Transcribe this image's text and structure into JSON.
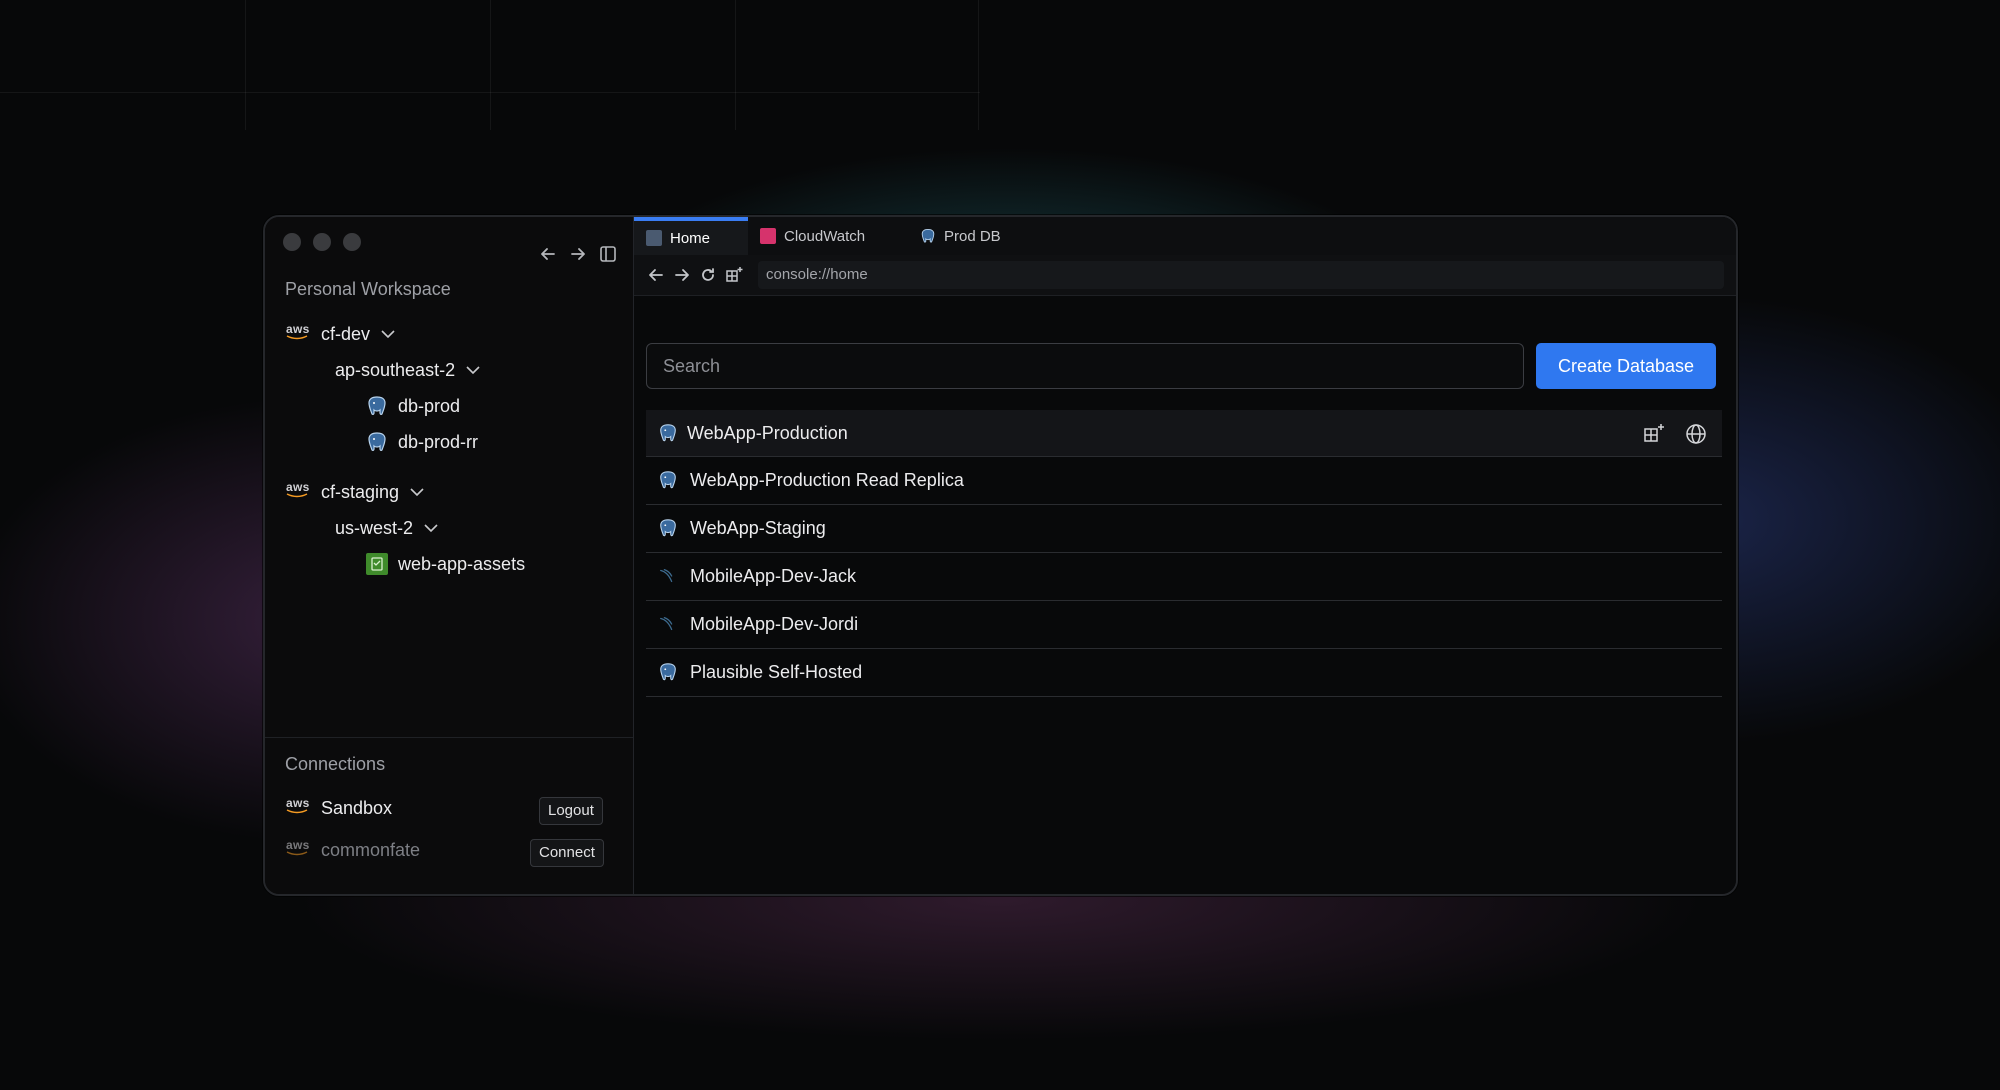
{
  "window": {
    "sidebar": {
      "workspace_title": "Personal Workspace",
      "tree": [
        {
          "provider": "aws",
          "label": "cf-dev",
          "expanded": true,
          "regions": [
            {
              "label": "ap-southeast-2",
              "expanded": true,
              "resources": [
                {
                  "type": "postgres",
                  "label": "db-prod"
                },
                {
                  "type": "postgres",
                  "label": "db-prod-rr"
                }
              ]
            }
          ]
        },
        {
          "provider": "aws",
          "label": "cf-staging",
          "expanded": true,
          "regions": [
            {
              "label": "us-west-2",
              "expanded": true,
              "resources": [
                {
                  "type": "s3",
                  "label": "web-app-assets"
                }
              ]
            }
          ]
        }
      ],
      "connections_title": "Connections",
      "connections": [
        {
          "provider": "aws",
          "label": "Sandbox",
          "action": "Logout",
          "active": true
        },
        {
          "provider": "aws",
          "label": "commonfate",
          "action": "Connect",
          "active": false
        }
      ],
      "aws_label": "aws"
    },
    "tabs": [
      {
        "label": "Home",
        "icon": "home-icon",
        "active": true
      },
      {
        "label": "CloudWatch",
        "icon": "cloudwatch-icon",
        "active": false
      },
      {
        "label": "Prod DB",
        "icon": "postgres-icon",
        "active": false
      }
    ],
    "address": "console://home",
    "search": {
      "placeholder": "Search",
      "value": ""
    },
    "create_button": "Create Database",
    "databases": [
      {
        "label": "WebApp-Production",
        "icon": "postgres-icon",
        "highlighted": true
      },
      {
        "label": "WebApp-Production Read Replica",
        "icon": "postgres-icon"
      },
      {
        "label": "WebApp-Staging",
        "icon": "postgres-icon"
      },
      {
        "label": "MobileApp-Dev-Jack",
        "icon": "mysql-icon"
      },
      {
        "label": "MobileApp-Dev-Jordi",
        "icon": "mysql-icon"
      },
      {
        "label": "Plausible Self-Hosted",
        "icon": "postgres-icon"
      }
    ],
    "colors": {
      "accent": "#2f78f0",
      "s3": "#3f8b2b",
      "cloudwatch": "#d6336c"
    }
  }
}
